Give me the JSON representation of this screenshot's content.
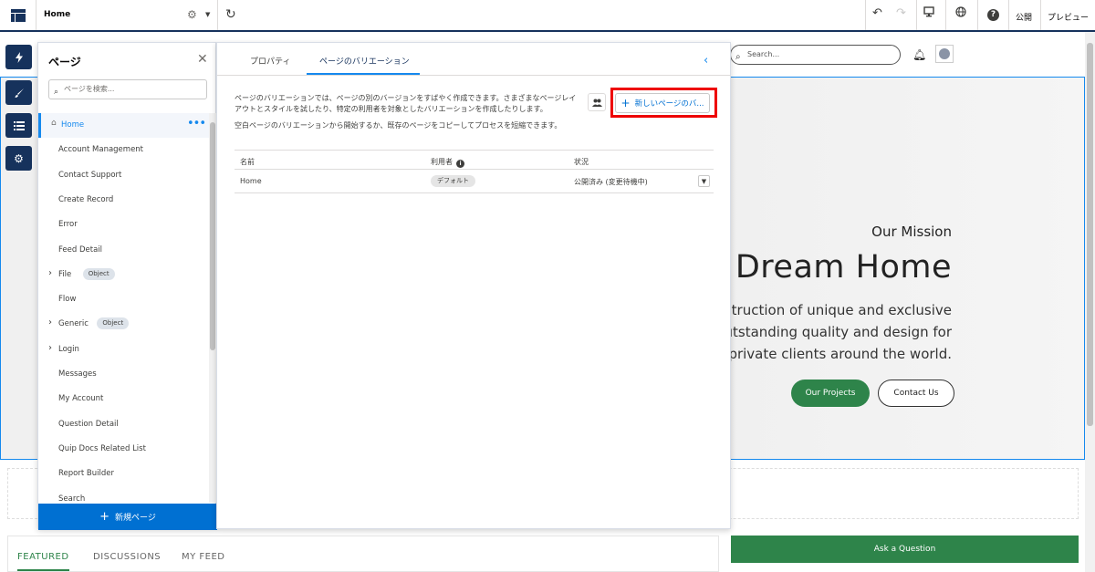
{
  "toolbar": {
    "page_title": "Home",
    "publish_label": "公開",
    "preview_label": "プレビュー"
  },
  "site": {
    "search_placeholder": "Search...",
    "hero": {
      "mission": "Our Mission",
      "title": "Dream Home",
      "line1": "e construction of unique and exclusive",
      "line2": "ver outstanding quality and design for",
      "line3": "s and private clients around the world.",
      "primary_button": "Our Projects",
      "secondary_button": "Contact Us"
    },
    "feed_tabs": [
      "FEATURED",
      "DISCUSSIONS",
      "MY FEED"
    ],
    "ask_button": "Ask a Question"
  },
  "pages_panel": {
    "title": "ページ",
    "search_placeholder": "ページを検索...",
    "new_page_label": "新規ページ",
    "items": [
      {
        "label": "Home",
        "active": true,
        "expandable": false,
        "badge": ""
      },
      {
        "label": "Account Management",
        "active": false,
        "expandable": false,
        "badge": ""
      },
      {
        "label": "Contact Support",
        "active": false,
        "expandable": false,
        "badge": ""
      },
      {
        "label": "Create Record",
        "active": false,
        "expandable": false,
        "badge": ""
      },
      {
        "label": "Error",
        "active": false,
        "expandable": false,
        "badge": ""
      },
      {
        "label": "Feed Detail",
        "active": false,
        "expandable": false,
        "badge": ""
      },
      {
        "label": "File",
        "active": false,
        "expandable": true,
        "badge": "Object"
      },
      {
        "label": "Flow",
        "active": false,
        "expandable": false,
        "badge": ""
      },
      {
        "label": "Generic",
        "active": false,
        "expandable": true,
        "badge": "Object"
      },
      {
        "label": "Login",
        "active": false,
        "expandable": true,
        "badge": ""
      },
      {
        "label": "Messages",
        "active": false,
        "expandable": false,
        "badge": ""
      },
      {
        "label": "My Account",
        "active": false,
        "expandable": false,
        "badge": ""
      },
      {
        "label": "Question Detail",
        "active": false,
        "expandable": false,
        "badge": ""
      },
      {
        "label": "Quip Docs Related List",
        "active": false,
        "expandable": false,
        "badge": ""
      },
      {
        "label": "Report Builder",
        "active": false,
        "expandable": false,
        "badge": ""
      },
      {
        "label": "Search",
        "active": false,
        "expandable": false,
        "badge": ""
      }
    ]
  },
  "props_panel": {
    "tabs": [
      "プロパティ",
      "ページのバリエーション"
    ],
    "active_tab": "ページのバリエーション",
    "desc_line1": "ページのバリエーションでは、ページの別のバージョンをすばやく作成できます。さまざまなページレイ",
    "desc_line2": "アウトとスタイルを試したり、特定の利用者を対象としたバリエーションを作成したりします。",
    "desc_line3": "空白ページのバリエーションから開始するか、既存のページをコピーしてプロセスを短縮できます。",
    "new_variation_button": "新しいページのバ...",
    "columns": {
      "name": "名前",
      "audience": "利用者",
      "status": "状況"
    },
    "rows": [
      {
        "name": "Home",
        "audience": "デフォルト",
        "status": "公開済み (変更待機中)"
      }
    ]
  }
}
